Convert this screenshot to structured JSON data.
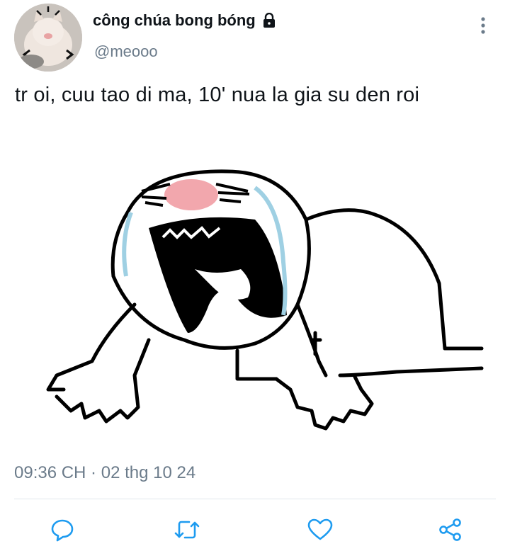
{
  "author": {
    "display_name": "công chúa bong bóng",
    "handle": "@meooo",
    "avatar_icon": "cat-avatar",
    "protected_icon": "lock-icon"
  },
  "tweet": {
    "text": "tr oi, cuu tao di ma, 10' nua la gia su den roi",
    "media_icon": "crying-meme-drawing",
    "timestamp": "09:36 CH · 02 thg 10 24"
  },
  "actions": [
    {
      "name": "reply",
      "icon": "comment-icon"
    },
    {
      "name": "retweet",
      "icon": "retweet-icon"
    },
    {
      "name": "like",
      "icon": "heart-icon"
    },
    {
      "name": "share",
      "icon": "share-icon"
    }
  ],
  "colors": {
    "icon": "#1d9bf0",
    "secondary_text": "#6b7b8a",
    "divider": "#e1e8ed"
  }
}
